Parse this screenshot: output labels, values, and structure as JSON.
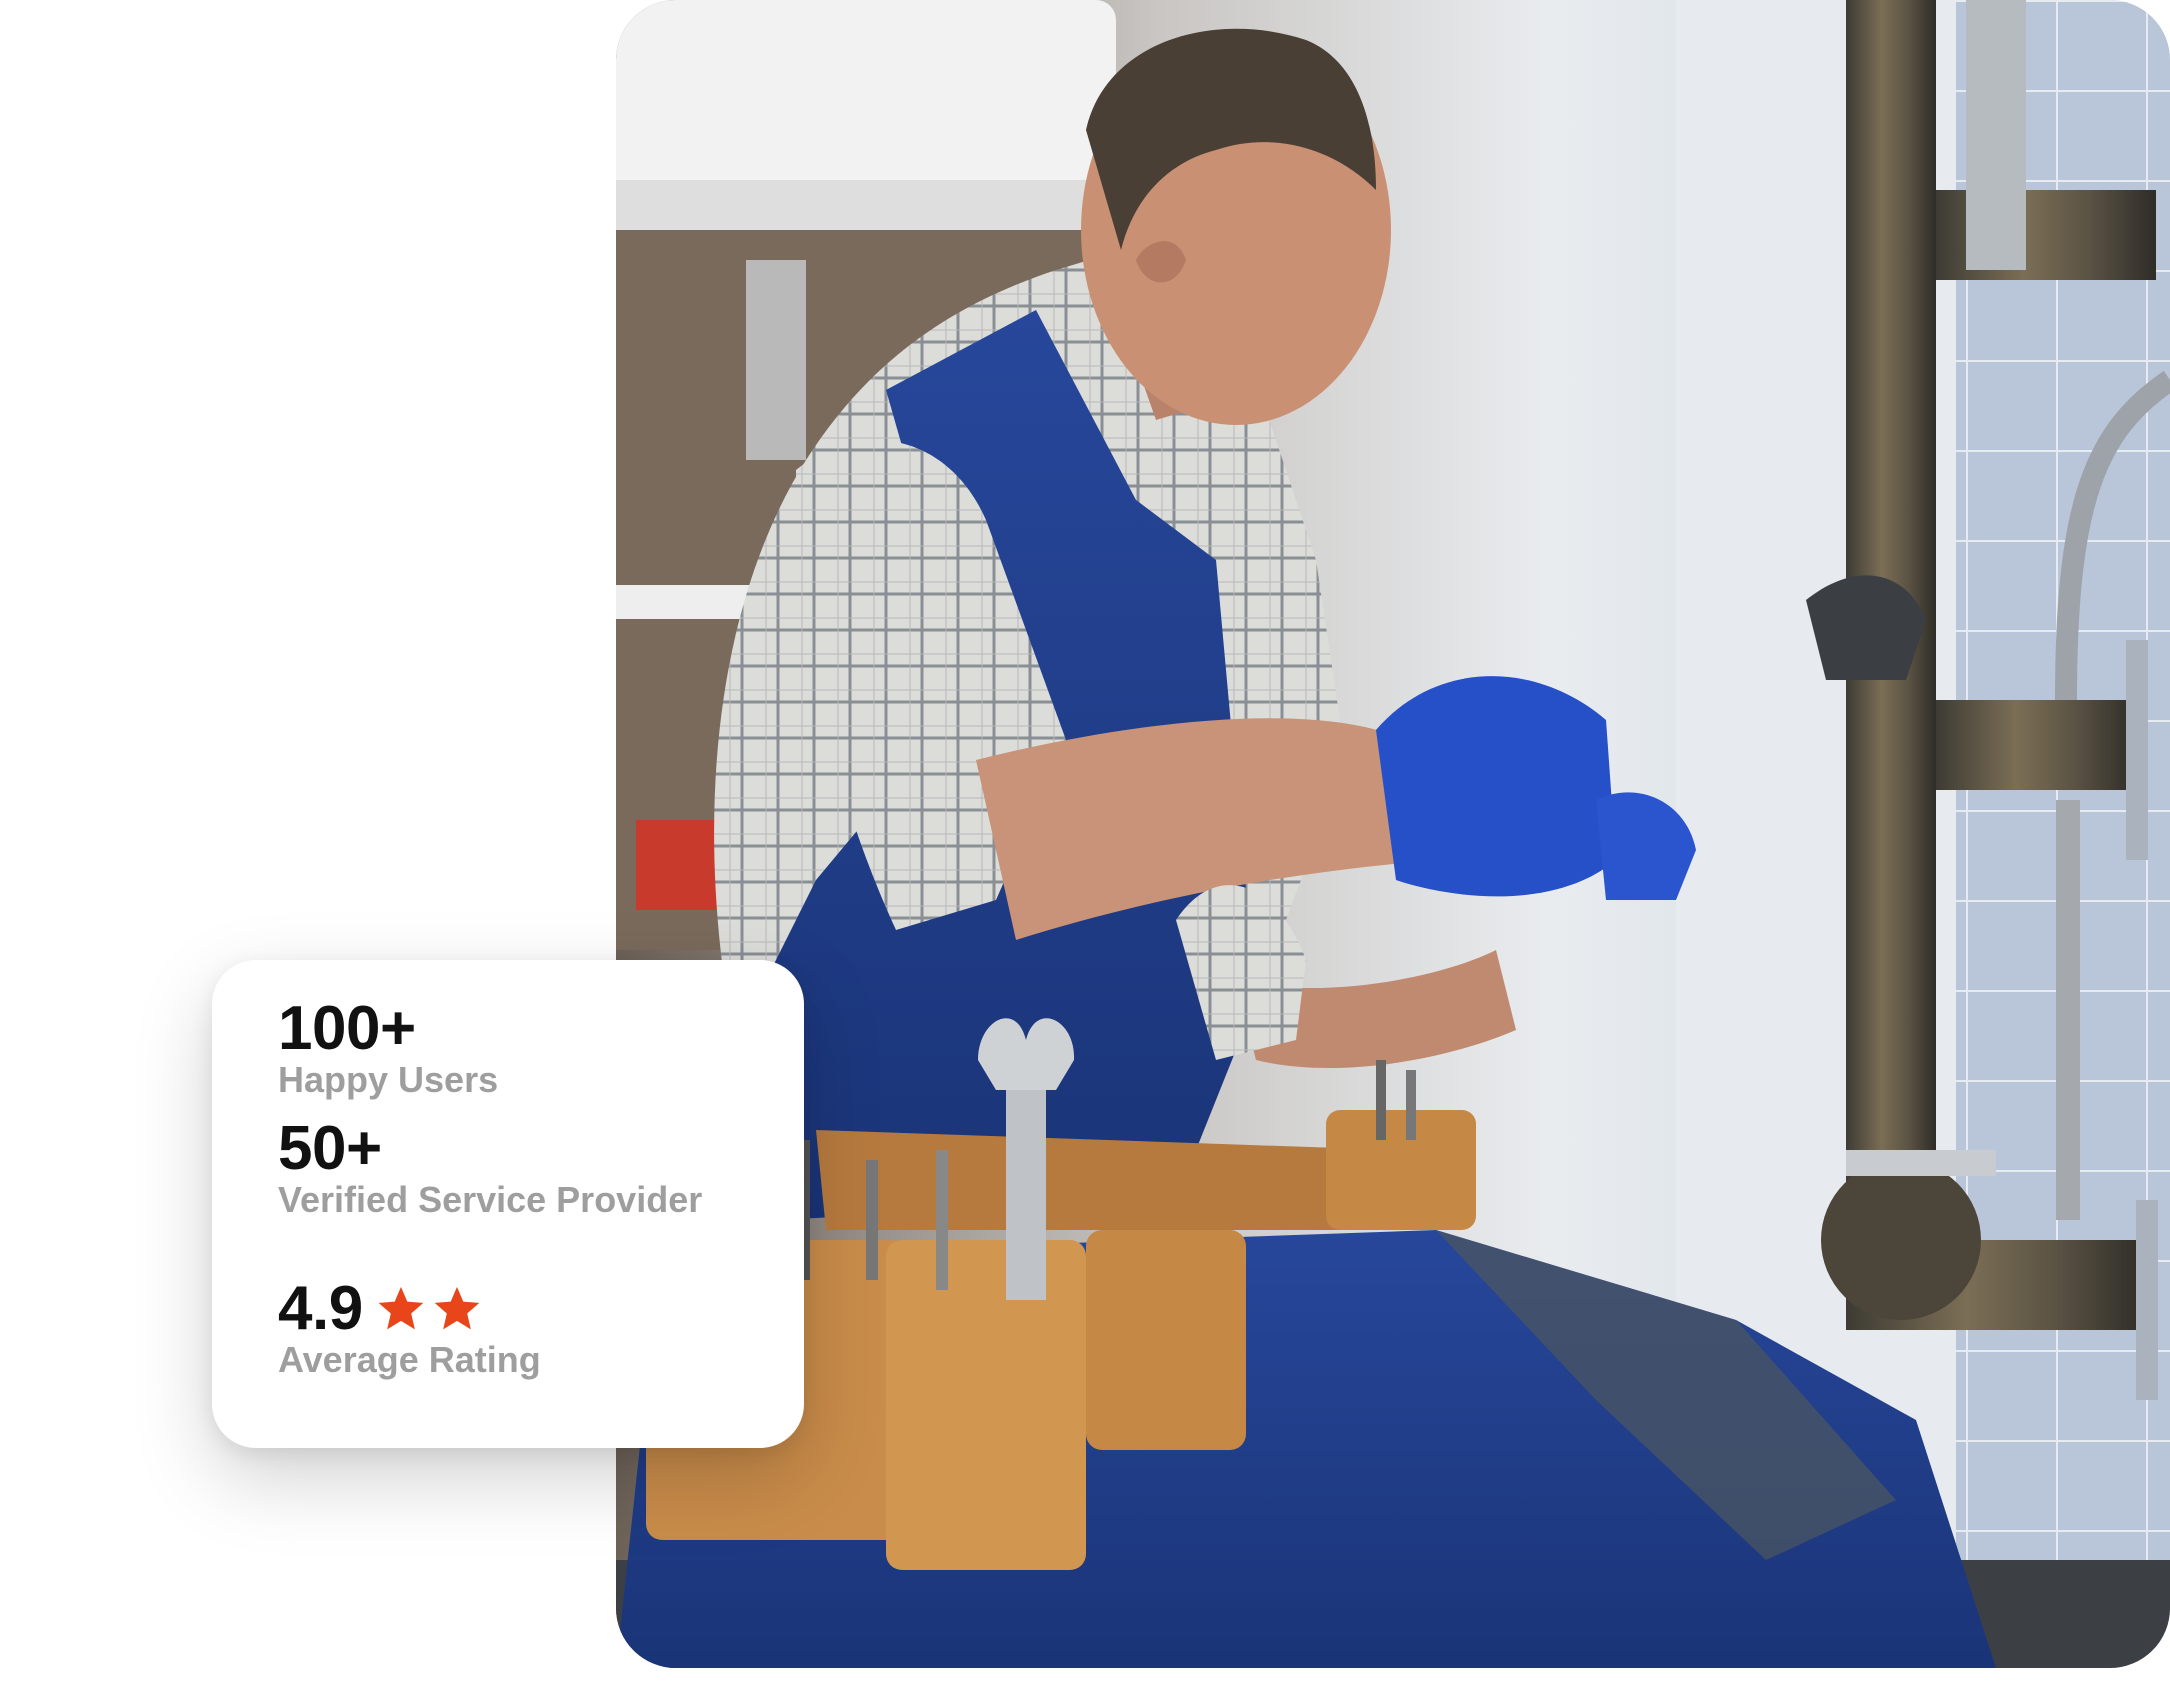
{
  "hero": {
    "image_alt": ""
  },
  "stats": {
    "users": {
      "value": "100+",
      "label": "Happy Users"
    },
    "providers": {
      "value": "50+",
      "label": "Verified Service Provider"
    },
    "rating": {
      "value": "4.9",
      "label": "Average Rating",
      "stars_shown": 2
    }
  },
  "colors": {
    "star": "#e8461a",
    "value_text": "#111111",
    "label_text": "#9e9e9e",
    "overall_blue": "#1e3f8f",
    "glove_blue": "#2550c8"
  },
  "icons": [
    "star-icon",
    "star-icon"
  ]
}
